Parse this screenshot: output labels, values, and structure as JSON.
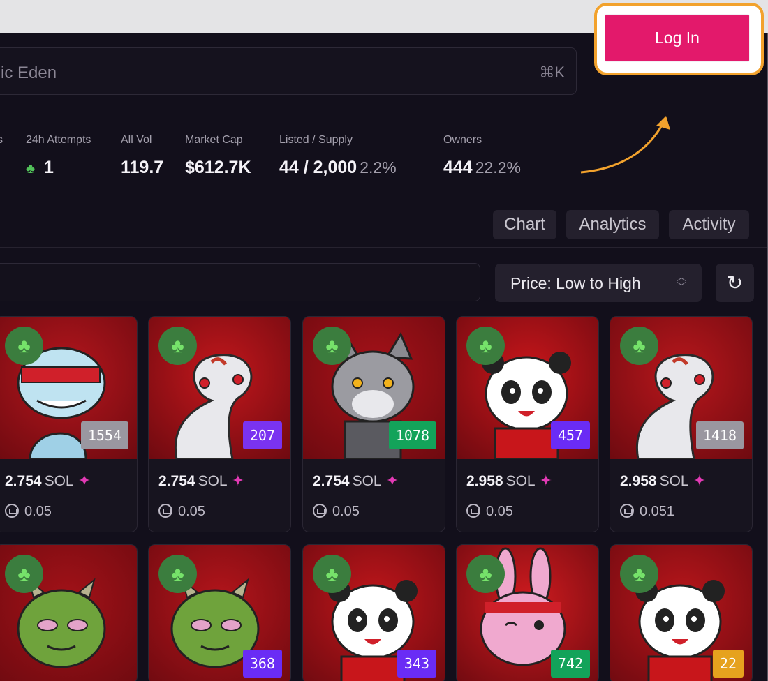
{
  "search": {
    "placeholder": "ic Eden",
    "shortcut": "⌘K"
  },
  "auth": {
    "login_label": "Log In"
  },
  "stats": [
    {
      "label": "s",
      "value": ""
    },
    {
      "label": "24h Attempts",
      "value": "1"
    },
    {
      "label": "All Vol",
      "value": "119.7"
    },
    {
      "label": "Market Cap",
      "value": "$612.7K"
    },
    {
      "label": "Listed / Supply",
      "value": "44 / 2,000",
      "sub": "2.2%"
    },
    {
      "label": "Owners",
      "value": "444",
      "sub": "22.2%"
    }
  ],
  "tabs": [
    "Chart",
    "Analytics",
    "Activity"
  ],
  "sort": {
    "label": "Price: Low to High"
  },
  "cards": [
    {
      "rank": "1554",
      "rank_color": "#9a97a0",
      "price": "2.754",
      "unit": "SOL",
      "fee": "0.05",
      "bg": "#b5161d",
      "char": "ghost"
    },
    {
      "rank": "207",
      "rank_color": "#7a33f0",
      "price": "2.754",
      "unit": "SOL",
      "fee": "0.05",
      "bg": "#c2171c",
      "char": "snake"
    },
    {
      "rank": "1078",
      "rank_color": "#13a35a",
      "price": "2.754",
      "unit": "SOL",
      "fee": "0.05",
      "bg": "#a81219",
      "char": "wolf"
    },
    {
      "rank": "457",
      "rank_color": "#6a2cf5",
      "price": "2.958",
      "unit": "SOL",
      "fee": "0.05",
      "bg": "#c8161b",
      "char": "panda"
    },
    {
      "rank": "1418",
      "rank_color": "#9a97a0",
      "price": "2.958",
      "unit": "SOL",
      "fee": "0.051",
      "bg": "#b8171c",
      "char": "snake"
    },
    {
      "rank": "",
      "rank_color": "",
      "bg": "#a31218",
      "char": "oni"
    },
    {
      "rank": "368",
      "rank_color": "#6a2cf5",
      "bg": "#b4151b",
      "char": "oni"
    },
    {
      "rank": "343",
      "rank_color": "#6a2cf5",
      "bg": "#c0161b",
      "char": "panda"
    },
    {
      "rank": "742",
      "rank_color": "#13a35a",
      "bg": "#cf1b1f",
      "char": "rabbit"
    },
    {
      "rank": "22",
      "rank_color": "#e6a21e",
      "bg": "#b9161b",
      "char": "panda"
    }
  ]
}
